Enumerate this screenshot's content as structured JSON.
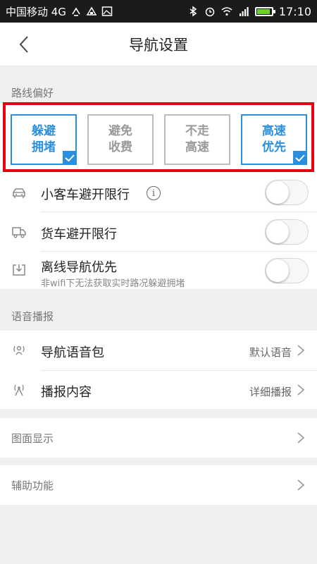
{
  "status_bar": {
    "carrier": "中国移动 4G",
    "time": "17:10"
  },
  "header": {
    "title": "导航设置"
  },
  "route_preference": {
    "section_label": "路线偏好",
    "options": [
      {
        "line1": "躲避",
        "line2": "拥堵",
        "selected": true
      },
      {
        "line1": "避免",
        "line2": "收费",
        "selected": false
      },
      {
        "line1": "不走",
        "line2": "高速",
        "selected": false
      },
      {
        "line1": "高速",
        "line2": "优先",
        "selected": true
      }
    ],
    "rows": [
      {
        "title": "小客车避开限行",
        "icon": "car-icon",
        "enabled": false
      },
      {
        "title": "货车避开限行",
        "icon": "truck-icon",
        "enabled": false
      },
      {
        "title": "离线导航优先",
        "subtitle": "非wifi下无法获取实时路况躲避拥堵",
        "icon": "download-icon",
        "enabled": false
      }
    ]
  },
  "voice": {
    "section_label": "语音播报",
    "rows": [
      {
        "title": "导航语音包",
        "value": "默认语音",
        "icon": "voice-pack-icon"
      },
      {
        "title": "播报内容",
        "value": "详细播报",
        "icon": "broadcast-icon"
      }
    ]
  },
  "map_display": {
    "title": "图面显示"
  },
  "assist": {
    "title": "辅助功能"
  },
  "colors": {
    "accent": "#2a8fde",
    "highlight": "#e60012",
    "background": "#f0f0f0"
  }
}
